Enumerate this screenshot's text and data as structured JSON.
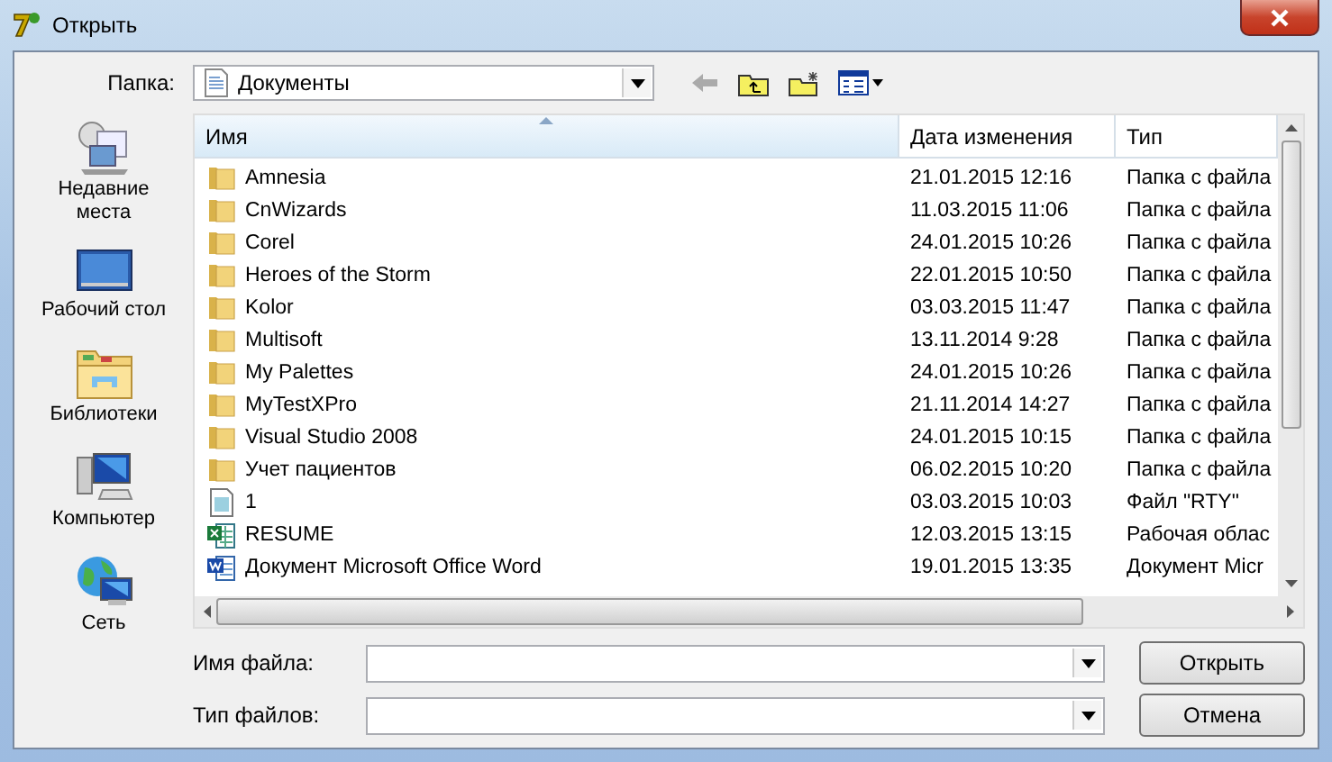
{
  "window": {
    "title": "Открыть"
  },
  "folder": {
    "label": "Папка:",
    "value": "Документы"
  },
  "places": [
    {
      "kind": "recent",
      "label": "Недавние места"
    },
    {
      "kind": "desktop",
      "label": "Рабочий стол"
    },
    {
      "kind": "libraries",
      "label": "Библиотеки"
    },
    {
      "kind": "computer",
      "label": "Компьютер"
    },
    {
      "kind": "network",
      "label": "Сеть"
    }
  ],
  "table": {
    "columns": [
      "Имя",
      "Дата изменения",
      "Тип"
    ],
    "rows": [
      {
        "kind": "folder",
        "name": "Amnesia",
        "date": "21.01.2015 12:16",
        "type": "Папка с файла"
      },
      {
        "kind": "folder",
        "name": "CnWizards",
        "date": "11.03.2015 11:06",
        "type": "Папка с файла"
      },
      {
        "kind": "folder",
        "name": "Corel",
        "date": "24.01.2015 10:26",
        "type": "Папка с файла"
      },
      {
        "kind": "folder",
        "name": "Heroes of the Storm",
        "date": "22.01.2015 10:50",
        "type": "Папка с файла"
      },
      {
        "kind": "folder",
        "name": "Kolor",
        "date": "03.03.2015 11:47",
        "type": "Папка с файла"
      },
      {
        "kind": "folder",
        "name": "Multisoft",
        "date": "13.11.2014 9:28",
        "type": "Папка с файла"
      },
      {
        "kind": "folder",
        "name": "My Palettes",
        "date": "24.01.2015 10:26",
        "type": "Папка с файла"
      },
      {
        "kind": "folder",
        "name": "MyTestXPro",
        "date": "21.11.2014 14:27",
        "type": "Папка с файла"
      },
      {
        "kind": "folder",
        "name": "Visual Studio 2008",
        "date": "24.01.2015 10:15",
        "type": "Папка с файла"
      },
      {
        "kind": "folder",
        "name": "Учет пациентов",
        "date": "06.02.2015 10:20",
        "type": "Папка с файла"
      },
      {
        "kind": "file",
        "name": "1",
        "date": "03.03.2015 10:03",
        "type": "Файл \"RTY\""
      },
      {
        "kind": "excel",
        "name": "RESUME",
        "date": "12.03.2015 13:15",
        "type": "Рабочая облас"
      },
      {
        "kind": "word",
        "name": "Документ Microsoft Office Word",
        "date": "19.01.2015 13:35",
        "type": "Документ Micr"
      }
    ]
  },
  "filename": {
    "label": "Имя файла:"
  },
  "filetype": {
    "label": "Тип файлов:"
  },
  "buttons": [
    "Открыть",
    "Отмена"
  ]
}
